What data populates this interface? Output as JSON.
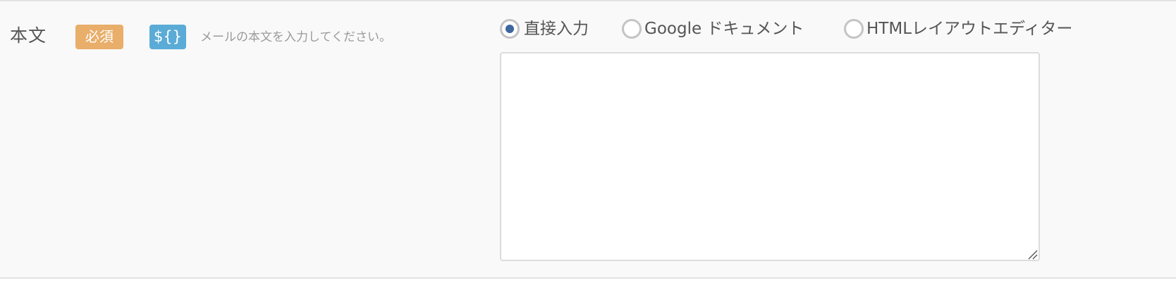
{
  "field": {
    "label": "本文",
    "required_badge": "必須",
    "variable_badge": "${}",
    "hint": "メールの本文を入力してください。"
  },
  "editor_mode": {
    "options": [
      {
        "label": "直接入力",
        "checked": true
      },
      {
        "label": "Google ドキュメント",
        "checked": false
      },
      {
        "label": "HTMLレイアウトエディター",
        "checked": false
      }
    ]
  },
  "body_input": {
    "value": "",
    "placeholder": ""
  },
  "colors": {
    "required_badge": "#e8ae6a",
    "variable_badge": "#5aabd6",
    "radio_checked": "#3d679e"
  }
}
